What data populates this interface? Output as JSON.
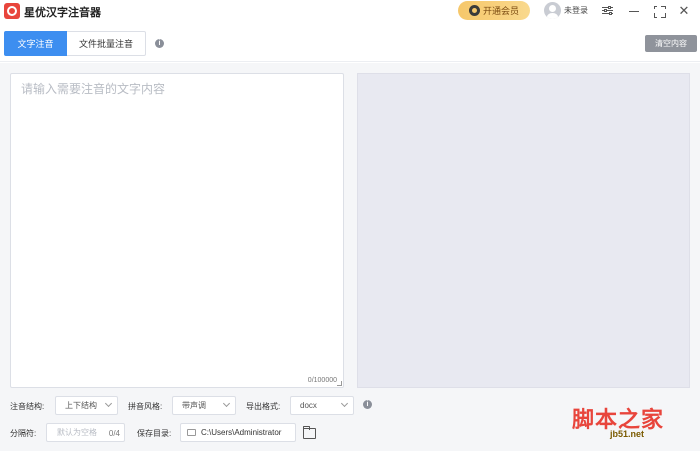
{
  "window": {
    "title": "星优汉字注音器",
    "vip_label": "开通会员",
    "user_label": "未登录"
  },
  "tabs": [
    {
      "label": "文字注音",
      "active": true
    },
    {
      "label": "文件批量注音",
      "active": false
    }
  ],
  "toolbar": {
    "clear_label": "清空内容"
  },
  "editor": {
    "placeholder": "请输入需要注音的文字内容",
    "char_count": "0/100000"
  },
  "options": {
    "structure": {
      "label": "注音结构:",
      "value": "上下结构"
    },
    "style": {
      "label": "拼音风格:",
      "value": "带声调"
    },
    "format": {
      "label": "导出格式:",
      "value": "docx"
    },
    "separator": {
      "label": "分隔符:",
      "placeholder": "默认为空格",
      "count": "0/4"
    },
    "save_dir": {
      "label": "保存目录:",
      "value": "C:\\Users\\Administrator"
    }
  },
  "watermark": {
    "big": "脚本之家",
    "small": "jb51.net"
  },
  "colors": {
    "accent": "#3d8ef0",
    "vip_gold": "#f6c76a",
    "clear_button": "#8f939b",
    "output_bg": "#e8e9f1"
  }
}
